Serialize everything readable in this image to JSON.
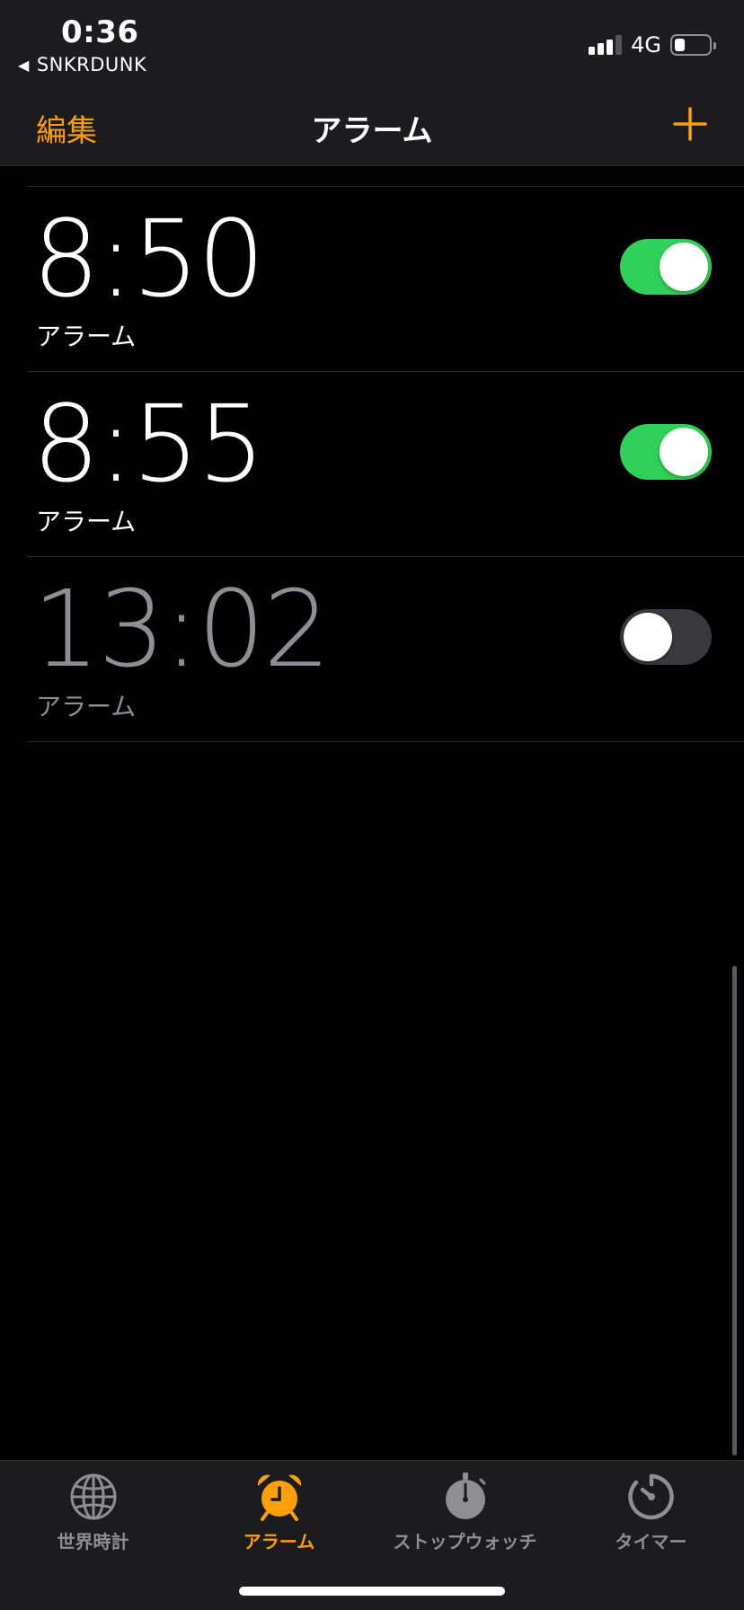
{
  "status_bar": {
    "time": "0:36",
    "back_app": "SNKRDUNK",
    "network": "4G",
    "battery_percent": 30
  },
  "nav": {
    "edit_label": "編集",
    "title": "アラーム",
    "add_icon": "plus-icon"
  },
  "alarms": [
    {
      "time": "8:50",
      "label": "アラーム",
      "enabled": true
    },
    {
      "time": "8:55",
      "label": "アラーム",
      "enabled": true
    },
    {
      "time": "13:02",
      "label": "アラーム",
      "enabled": false
    }
  ],
  "tabs": [
    {
      "label": "世界時計",
      "icon": "globe-icon",
      "active": false
    },
    {
      "label": "アラーム",
      "icon": "alarm-clock-icon",
      "active": true
    },
    {
      "label": "ストップウォッチ",
      "icon": "stopwatch-icon",
      "active": false
    },
    {
      "label": "タイマー",
      "icon": "timer-icon",
      "active": false
    }
  ],
  "colors": {
    "accent": "#ff9f0a",
    "toggle_on": "#30d158",
    "toggle_off": "#39393d",
    "inactive": "#8e8e93"
  }
}
